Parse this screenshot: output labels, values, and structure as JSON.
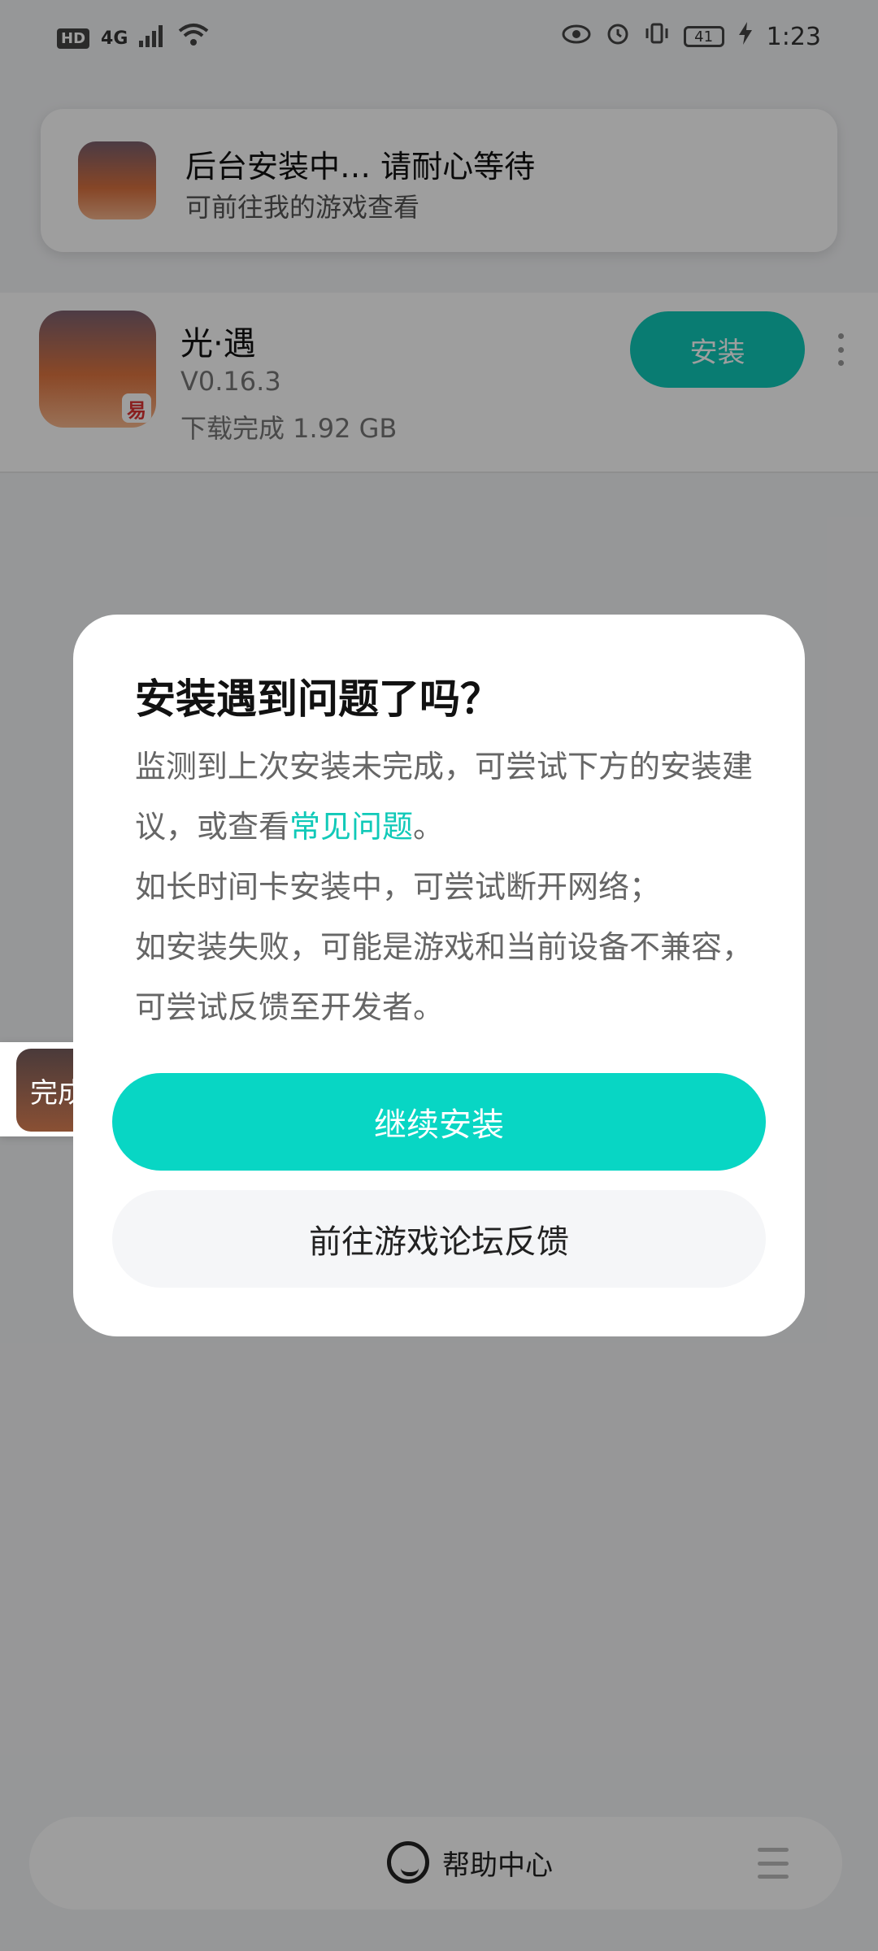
{
  "status_bar": {
    "hd": "HD",
    "network": "4G",
    "battery": "41",
    "time": "1:23"
  },
  "notice": {
    "title": "后台安装中… 请耐心等待",
    "subtitle": "可前往我的游戏查看"
  },
  "game": {
    "name": "光·遇",
    "version": "V0.16.3",
    "status": "下载完成  1.92 GB",
    "install_label": "安装",
    "logo_text": "易"
  },
  "dialog": {
    "title": "安装遇到问题了吗？",
    "line1_prefix": "监测到上次安装未完成，可尝试下方的安装建议，或查看",
    "faq_link": "常见问题",
    "line1_suffix": "。",
    "line2": "如长时间卡安装中，可尝试断开网络；",
    "line3": "如安装失败，可能是游戏和当前设备不兼容，可尝试反馈至开发者。",
    "continue_label": "继续安装",
    "forum_label": "前往游戏论坛反馈"
  },
  "float_widget": {
    "label": "完成"
  },
  "bottom_bar": {
    "help_label": "帮助中心"
  },
  "icons": [
    "eye-icon",
    "alarm-icon",
    "vibrate-icon",
    "battery-icon",
    "charging-icon",
    "wifi-icon",
    "signal-icon",
    "headset-icon",
    "menu-icon",
    "more-icon"
  ]
}
